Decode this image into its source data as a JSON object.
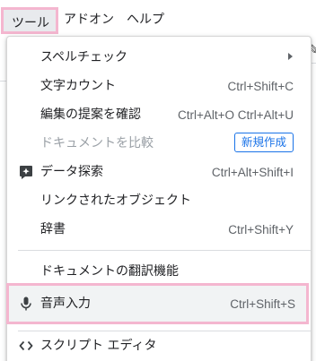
{
  "menubar": {
    "tools": "ツール",
    "addons": "アドオン",
    "help": "ヘルプ"
  },
  "menu": {
    "spelling": "スペルチェック",
    "word_count": {
      "label": "文字カウント",
      "shortcut": "Ctrl+Shift+C"
    },
    "review_suggestions": {
      "label": "編集の提案を確認",
      "shortcut": "Ctrl+Alt+O Ctrl+Alt+U"
    },
    "compare_documents": {
      "label": "ドキュメントを比較",
      "badge": "新規作成"
    },
    "explore": {
      "label": "データ探索",
      "shortcut": "Ctrl+Alt+Shift+I"
    },
    "linked_objects": {
      "label": "リンクされたオブジェクト"
    },
    "dictionary": {
      "label": "辞書",
      "shortcut": "Ctrl+Shift+Y"
    },
    "translate_document": {
      "label": "ドキュメントの翻訳機能"
    },
    "voice_typing": {
      "label": "音声入力",
      "shortcut": "Ctrl+Shift+S"
    },
    "script_editor": {
      "label": "スクリプト エディタ"
    }
  },
  "colors": {
    "highlight_border": "#f4b6cf",
    "badge_blue": "#1a73e8",
    "disabled_text": "#9aa0a6"
  },
  "icons": {
    "explore": "explore-plus-icon",
    "voice": "microphone-icon",
    "script": "code-brackets-icon",
    "submenu": "submenu-arrow-icon"
  }
}
